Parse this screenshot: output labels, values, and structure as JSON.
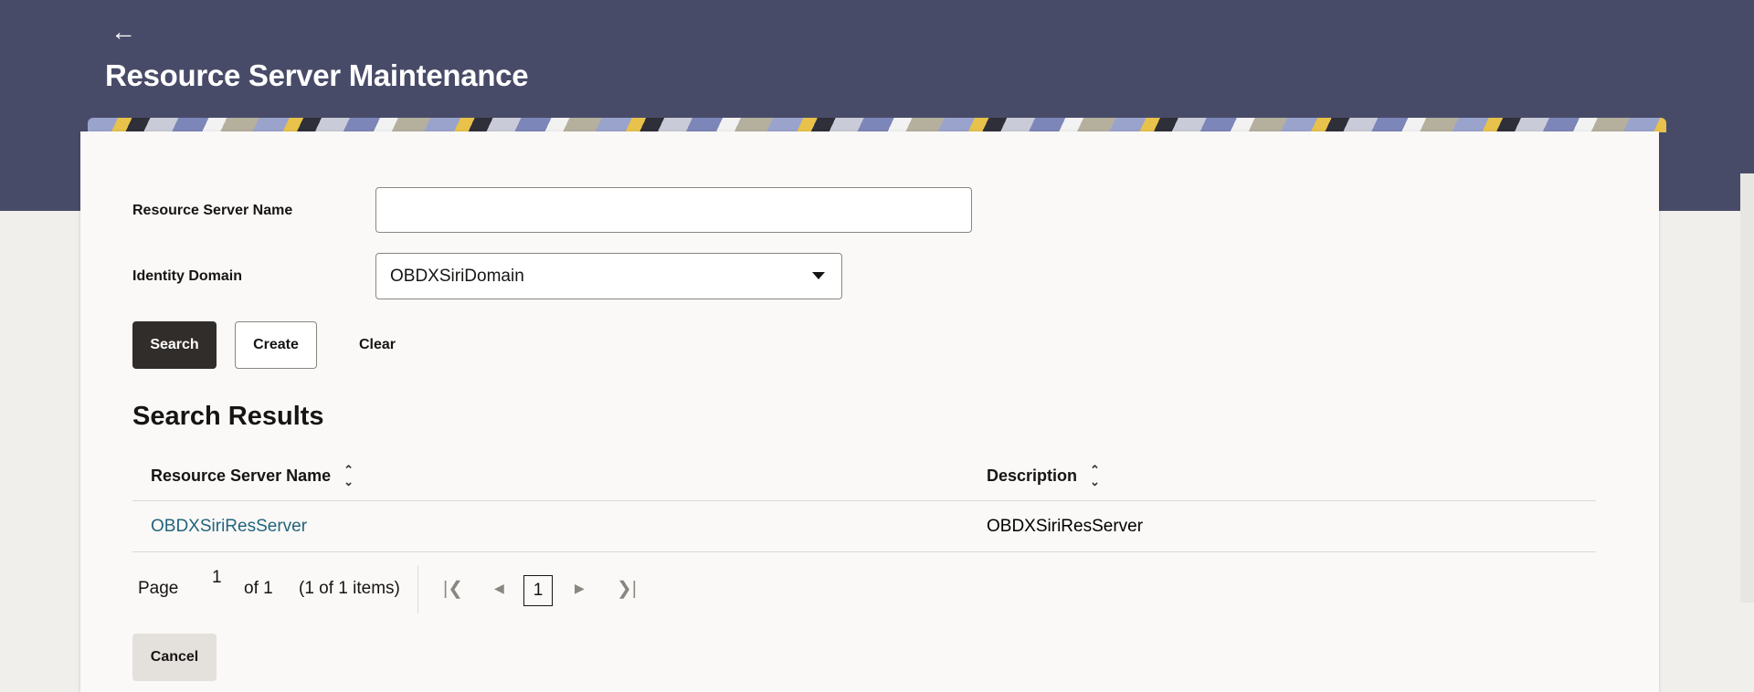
{
  "header": {
    "back_icon": "arrow-left-icon",
    "title": "Resource Server Maintenance"
  },
  "form": {
    "resource_server_name_label": "Resource Server Name",
    "resource_server_name_value": "",
    "identity_domain_label": "Identity Domain",
    "identity_domain_value": "OBDXSiriDomain"
  },
  "actions": {
    "search": "Search",
    "create": "Create",
    "clear": "Clear",
    "cancel": "Cancel"
  },
  "results": {
    "title": "Search Results",
    "columns": [
      "Resource Server Name",
      "Description"
    ],
    "rows": [
      {
        "name": "OBDXSiriResServer",
        "description": "OBDXSiriResServer"
      }
    ]
  },
  "pagination": {
    "page_label": "Page",
    "page_value": "1",
    "of_label": "of 1",
    "items_label": "(1 of 1 items)",
    "current_page": "1"
  },
  "colors": {
    "header_bg": "#484b68",
    "primary_button": "#312d2a",
    "link": "#22637e"
  }
}
